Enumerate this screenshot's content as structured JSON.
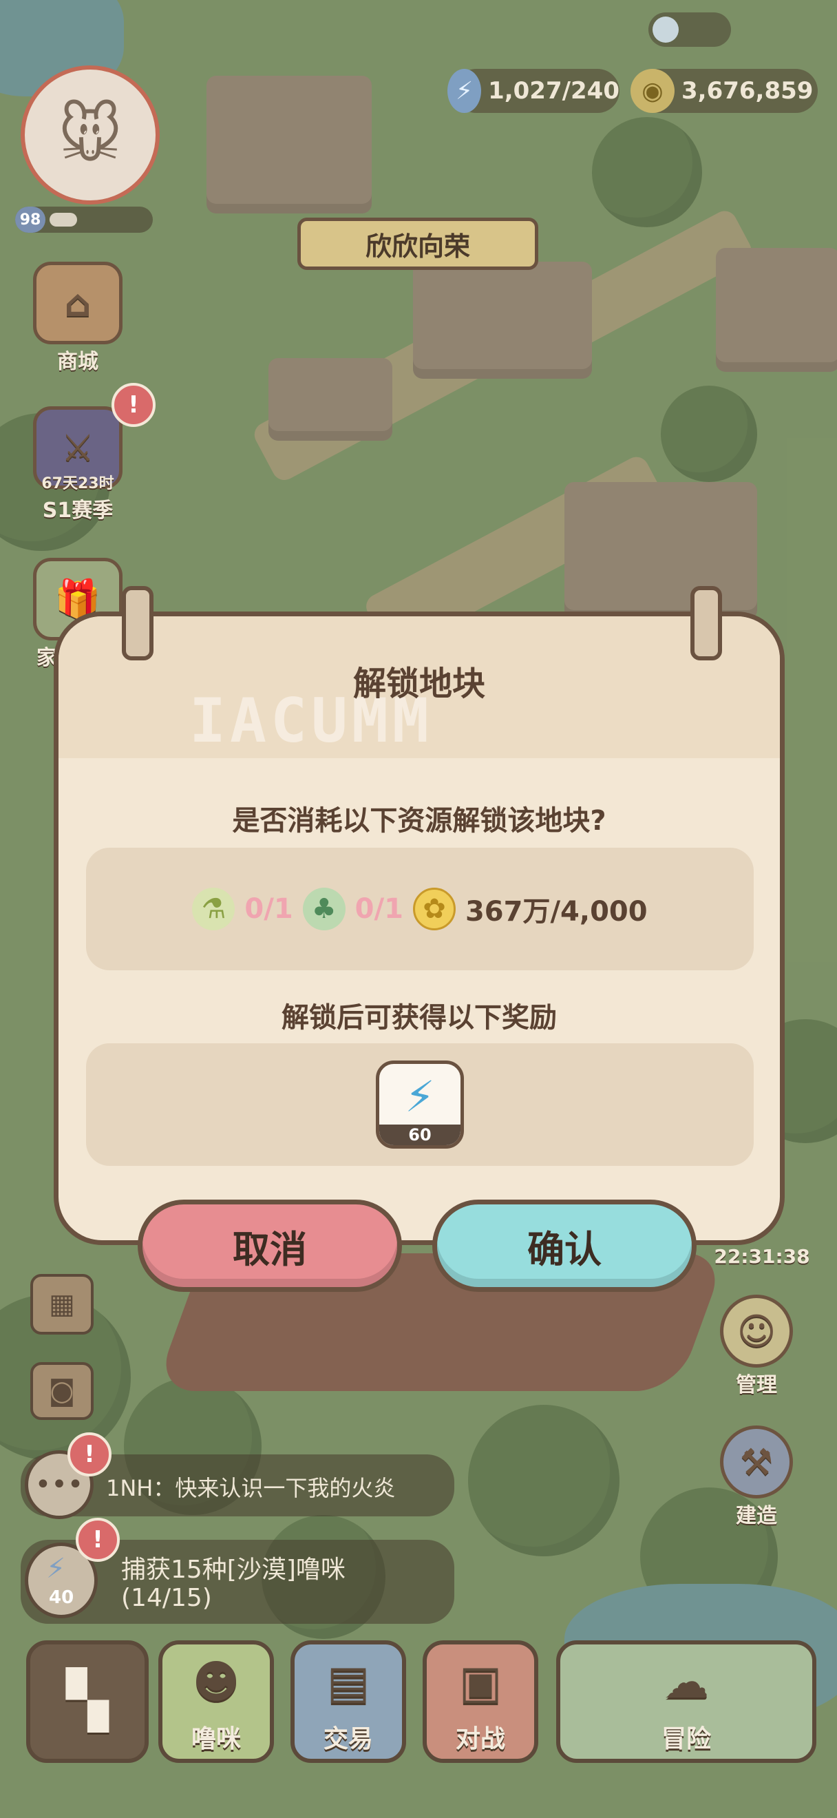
{
  "hud": {
    "energy": "1,027/240",
    "coins": "3,676,859",
    "level": "98",
    "area_banner": "欣欣向荣",
    "timer": "22:31:38"
  },
  "left_menu": {
    "shop_label": "商城",
    "season_timer": "67天23时",
    "season_label": "S1赛季",
    "gift_label": "家园礼包"
  },
  "right_menu": {
    "manage_label": "管理",
    "build_label": "建造"
  },
  "chat": {
    "message": "1NH：快来认识一下我的火炎"
  },
  "quest": {
    "text_line1": "捕获15种[沙漠]噜咪",
    "text_line2": "(14/15)",
    "reward_count": "40"
  },
  "bottom_nav": {
    "items": [
      {
        "label": "噜咪"
      },
      {
        "label": "交易"
      },
      {
        "label": "对战"
      },
      {
        "label": "冒险"
      }
    ]
  },
  "dialog": {
    "title": "解锁地块",
    "watermark": "IACUMM",
    "question": "是否消耗以下资源解锁该地块?",
    "costs": [
      {
        "icon": "potion-bottle-icon",
        "amount": "0/1",
        "status": "lacking"
      },
      {
        "icon": "frog-lantern-icon",
        "amount": "0/1",
        "status": "lacking"
      },
      {
        "icon": "gold-coin-icon",
        "amount": "367万/4,000",
        "status": "enough"
      }
    ],
    "reward_title": "解锁后可获得以下奖励",
    "reward": {
      "icon": "energy-bolt-icon",
      "count": "60"
    },
    "cancel_label": "取消",
    "confirm_label": "确认"
  },
  "colors": {
    "cancel": "#e78d91",
    "confirm": "#97dddd",
    "dialog_bg": "#f3e7d4",
    "lacking_text": "#f0a5b0"
  }
}
